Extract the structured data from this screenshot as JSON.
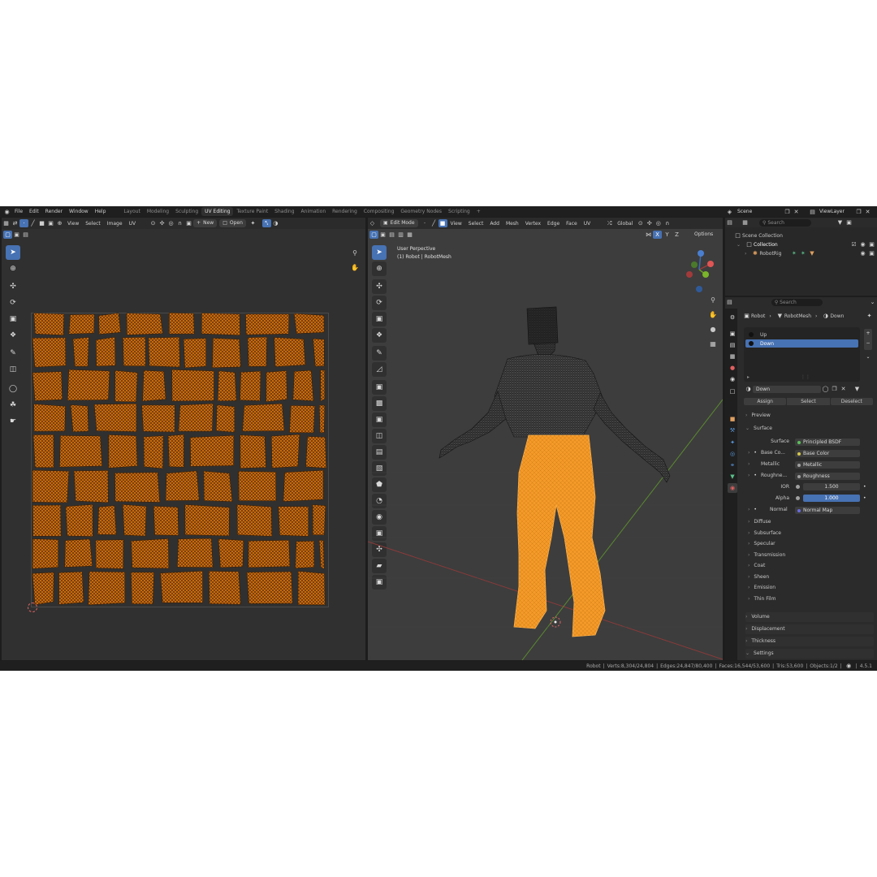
{
  "topbar": {
    "menu": [
      "File",
      "Edit",
      "Render",
      "Window",
      "Help"
    ],
    "workspaces": [
      "Layout",
      "Modeling",
      "Sculpting",
      "UV Editing",
      "Texture Paint",
      "Shading",
      "Animation",
      "Rendering",
      "Compositing",
      "Geometry Nodes",
      "Scripting"
    ],
    "active_workspace": "UV Editing",
    "scene": "Scene",
    "view_layer": "ViewLayer"
  },
  "uv_editor": {
    "menu": [
      "View",
      "Select",
      "Image",
      "UV"
    ],
    "new_label": "New",
    "open_label": "Open",
    "island_color": "#c76a0f"
  },
  "viewport": {
    "mode": "Edit Mode",
    "menu": [
      "View",
      "Select",
      "Add",
      "Mesh",
      "Vertex",
      "Edge",
      "Face",
      "UV"
    ],
    "orientation": "Global",
    "axes": [
      "X",
      "Y",
      "Z"
    ],
    "options_label": "Options",
    "overlay_title": "User Perpective",
    "overlay_sub": "(1) Robot | RobotMesh"
  },
  "outliner": {
    "search_placeholder": "Search",
    "scene_collection": "Scene Collection",
    "collection": "Collection",
    "rig": "RobotRig"
  },
  "properties": {
    "search_placeholder": "Search",
    "breadcrumb": [
      "Robot",
      "RobotMesh",
      "Down"
    ],
    "slots": [
      "Up",
      "Down"
    ],
    "active_slot": "Down",
    "material_name": "Down",
    "assign_label": "Assign",
    "select_label": "Select",
    "deselect_label": "Deselect",
    "preview_label": "Preview",
    "surface_label": "Surface",
    "surface_shader_label": "Surface",
    "surface_shader_value": "Principled BSDF",
    "inputs": [
      {
        "label": "Base Co...",
        "value": "Base Color"
      },
      {
        "label": "Metallic",
        "value": "Metallic"
      },
      {
        "label": "Roughne...",
        "value": "Roughness"
      }
    ],
    "ior_label": "IOR",
    "ior_value": "1.500",
    "alpha_label": "Alpha",
    "alpha_value": "1.000",
    "normal_label": "Normal",
    "normal_value": "Normal Map",
    "subpanels": [
      "Diffuse",
      "Subsurface",
      "Specular",
      "Transmission",
      "Coat",
      "Sheen",
      "Emission",
      "Thin Film"
    ],
    "sections": [
      "Volume",
      "Displacement",
      "Thickness",
      "Settings"
    ]
  },
  "statusbar": {
    "object": "Robot",
    "verts": "Verts:8,304/24,804",
    "edges": "Edges:24,847/80,400",
    "faces": "Faces:16,544/53,600",
    "tris": "Tris:53,600",
    "objects": "Objects:1/2",
    "version": "4.5.1"
  }
}
